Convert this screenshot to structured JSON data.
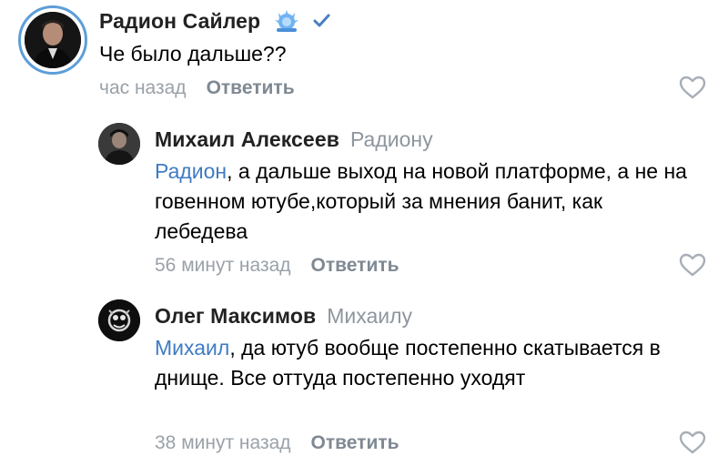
{
  "comments": [
    {
      "author": "Радион Сайлер",
      "reply_to": "",
      "mention": "",
      "text": "Че было дальше??",
      "time": "час назад",
      "reply_label": "Ответить"
    },
    {
      "author": "Михаил Алексеев",
      "reply_to": "Радиону",
      "mention": "Радион",
      "text": ", а дальше выход на новой платформе, а не на говенном ютубе,который за мнения банит, как лебедева",
      "time": "56 минут назад",
      "reply_label": "Ответить"
    },
    {
      "author": "Олег Максимов",
      "reply_to": "Михаилу",
      "mention": "Михаил",
      "text": ", да ютуб вообще постепенно скатывается в днище. Все оттуда постепенно уходят",
      "time": "38 минут назад",
      "reply_label": "Ответить"
    }
  ],
  "icons": {
    "badge": "blue-spiky-badge-icon",
    "verified": "verified-check-icon",
    "like": "heart-outline-icon"
  },
  "colors": {
    "mention": "#3f7bc3",
    "verified": "#4a7fc1",
    "meta": "#9aa1a8",
    "avatar_ring": "#5d9ed8"
  }
}
